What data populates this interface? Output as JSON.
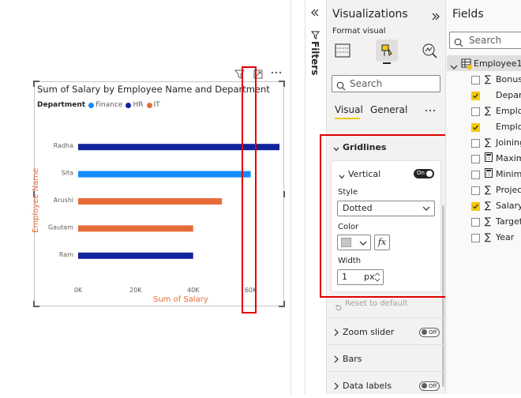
{
  "chart": {
    "title": "Sum of Salary by Employee Name and Department",
    "legend_title": "Department",
    "legend": [
      {
        "name": "Finance",
        "color": "#118dff"
      },
      {
        "name": "HR",
        "color": "#12239e"
      },
      {
        "name": "IT",
        "color": "#e66c37"
      }
    ],
    "xlabel": "Sum of Salary",
    "ylabel": "Employee Name"
  },
  "chart_data": {
    "type": "bar",
    "orientation": "horizontal",
    "title": "Sum of Salary by Employee Name and Department",
    "xlabel": "Sum of Salary",
    "ylabel": "Employee Name",
    "categories": [
      "Radha",
      "Sita",
      "Arushi",
      "Gautam",
      "Ram"
    ],
    "x_ticks": [
      "0K",
      "20K",
      "40K",
      "60K"
    ],
    "xlim": [
      0,
      70000
    ],
    "series": [
      {
        "name": "Finance",
        "color": "#118dff",
        "values": [
          null,
          60000,
          null,
          null,
          null
        ]
      },
      {
        "name": "HR",
        "color": "#12239e",
        "values": [
          70000,
          null,
          null,
          null,
          40000
        ]
      },
      {
        "name": "IT",
        "color": "#e66c37",
        "values": [
          null,
          null,
          50000,
          40000,
          null
        ]
      }
    ],
    "legend_position": "top-left",
    "grid": false
  },
  "filters": {
    "label": "Filters"
  },
  "visualizations": {
    "title": "Visualizations",
    "format_visual": "Format visual",
    "search_placeholder": "Search",
    "tabs": {
      "visual": "Visual",
      "general": "General"
    },
    "gridlines": {
      "header": "Gridlines",
      "vertical": {
        "label": "Vertical",
        "toggle": "On",
        "style_label": "Style",
        "style_value": "Dotted",
        "color_label": "Color",
        "color_value": "#c8c6c4",
        "width_label": "Width",
        "width_value": "1",
        "width_unit": "px"
      }
    },
    "reset": "Reset to default",
    "sections": [
      {
        "label": "Zoom slider",
        "toggle": "Off"
      },
      {
        "label": "Bars"
      },
      {
        "label": "Data labels",
        "toggle": "Off"
      }
    ]
  },
  "fields": {
    "title": "Fields",
    "search_placeholder": "Search",
    "table": "Employee1",
    "items": [
      {
        "name": "Bonus",
        "checked": false,
        "icon": "sigma"
      },
      {
        "name": "Depart",
        "checked": true,
        "icon": "none"
      },
      {
        "name": "Employ",
        "checked": false,
        "icon": "sigma"
      },
      {
        "name": "Employ",
        "checked": true,
        "icon": "none"
      },
      {
        "name": "Joining",
        "checked": false,
        "icon": "sigma"
      },
      {
        "name": "Maxim",
        "checked": false,
        "icon": "calc"
      },
      {
        "name": "Minim",
        "checked": false,
        "icon": "calc"
      },
      {
        "name": "Project",
        "checked": false,
        "icon": "sigma"
      },
      {
        "name": "Salary",
        "checked": true,
        "icon": "sigma"
      },
      {
        "name": "Targett",
        "checked": false,
        "icon": "sigma"
      },
      {
        "name": "Year",
        "checked": false,
        "icon": "sigma"
      }
    ]
  }
}
